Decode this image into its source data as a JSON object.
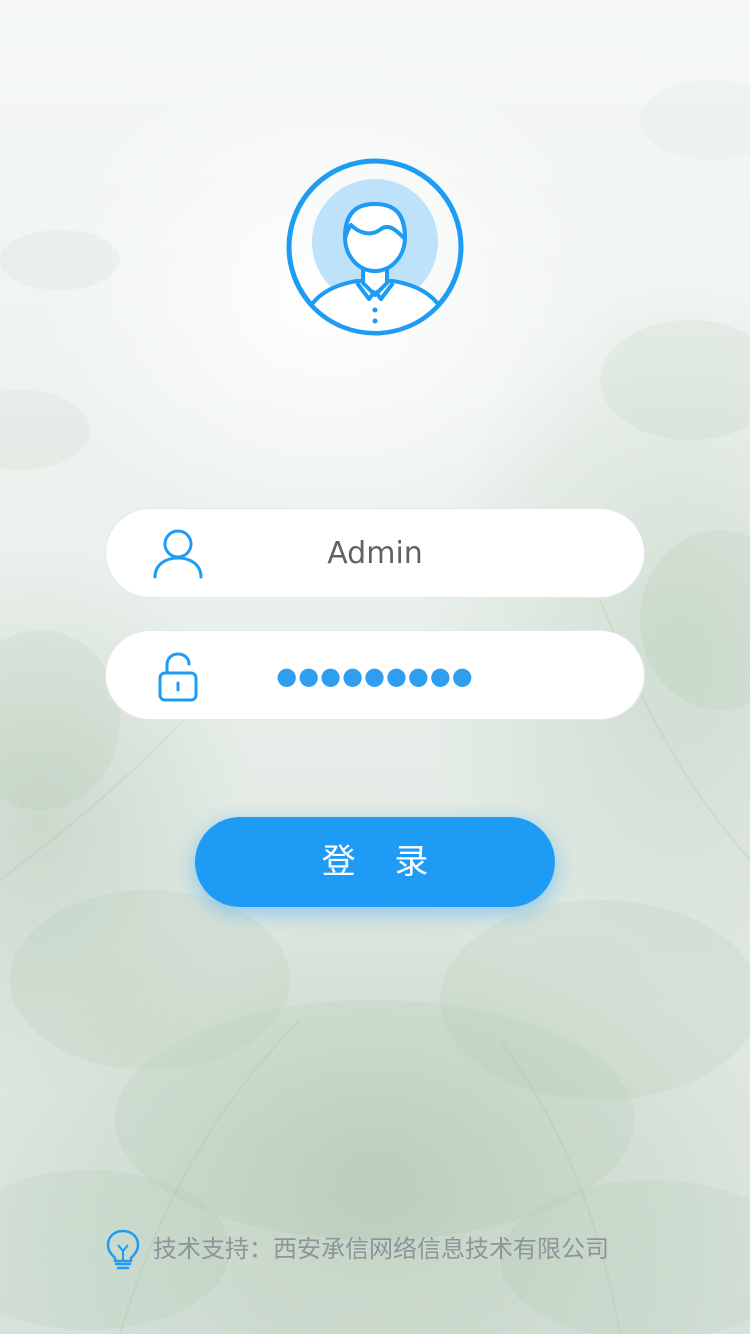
{
  "login_form": {
    "username_value": "Admin",
    "password_masked": "●●●●●●●●●",
    "login_button_label": "登 录"
  },
  "footer": {
    "support_text": "技术支持：西安承信网络信息技术有限公司"
  },
  "icons": {
    "avatar": "user-avatar-icon",
    "username": "user-icon",
    "password": "lock-icon",
    "footer": "lightbulb-icon"
  },
  "colors": {
    "accent": "#1e9cf5",
    "accent_light": "#bfe2fb",
    "field_bg": "#ffffff",
    "text_gray": "#5f6368",
    "footer_text": "#8f9498"
  }
}
